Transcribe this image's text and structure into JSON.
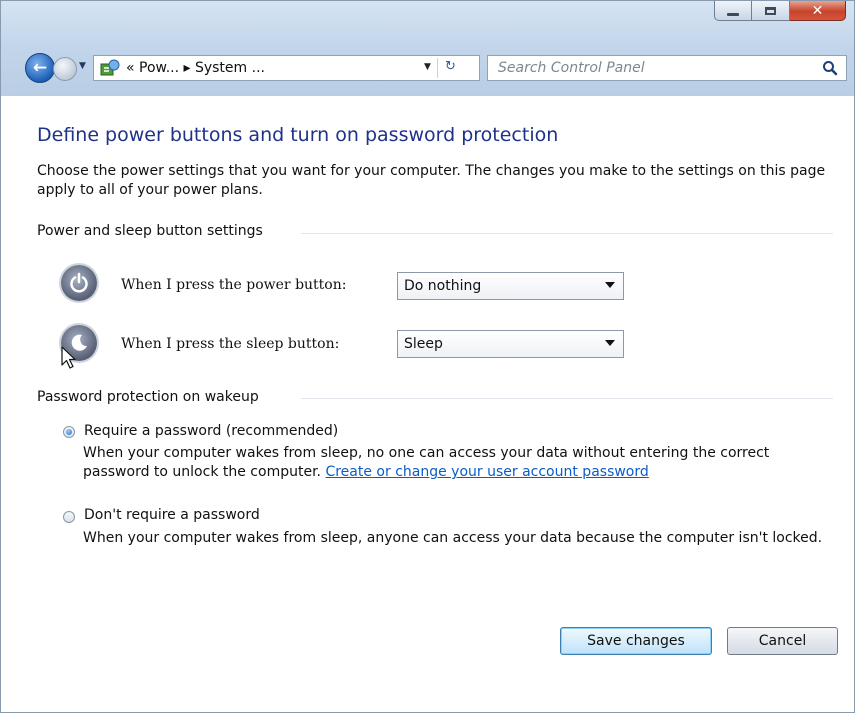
{
  "window": {
    "caption_icons": [
      "minimize-icon",
      "maximize-icon",
      "close-icon"
    ]
  },
  "navbar": {
    "breadcrumb": "« Pow... ▸ System ...",
    "search_placeholder": "Search Control Panel",
    "icons": [
      "back-arrow-icon",
      "forward-arrow-icon",
      "control-panel-icon",
      "refresh-icon",
      "search-icon"
    ]
  },
  "page": {
    "title": "Define power buttons and turn on password protection",
    "intro": "Choose the power settings that you want for your computer. The changes you make to the settings on this page apply to all of your power plans."
  },
  "power_section": {
    "heading": "Power and sleep button settings",
    "power_button_label": "When I press the power button:",
    "power_button_value": "Do nothing",
    "sleep_button_label": "When I press the sleep button:",
    "sleep_button_value": "Sleep"
  },
  "password_section": {
    "heading": "Password protection on wakeup",
    "require_label": "Require a password (recommended)",
    "require_desc": "When your computer wakes from sleep, no one can access your data without entering the correct password to unlock the computer.",
    "require_link": "Create or change your user account password",
    "require_selected": true,
    "no_require_label": "Don't require a password",
    "no_require_desc": "When your computer wakes from sleep, anyone can access your data because the computer isn't locked.",
    "no_require_selected": false
  },
  "footer": {
    "save_label": "Save changes",
    "cancel_label": "Cancel"
  },
  "colors": {
    "title": "#1e3287",
    "link": "#0b5cc9",
    "close_button": "#c5432b"
  }
}
